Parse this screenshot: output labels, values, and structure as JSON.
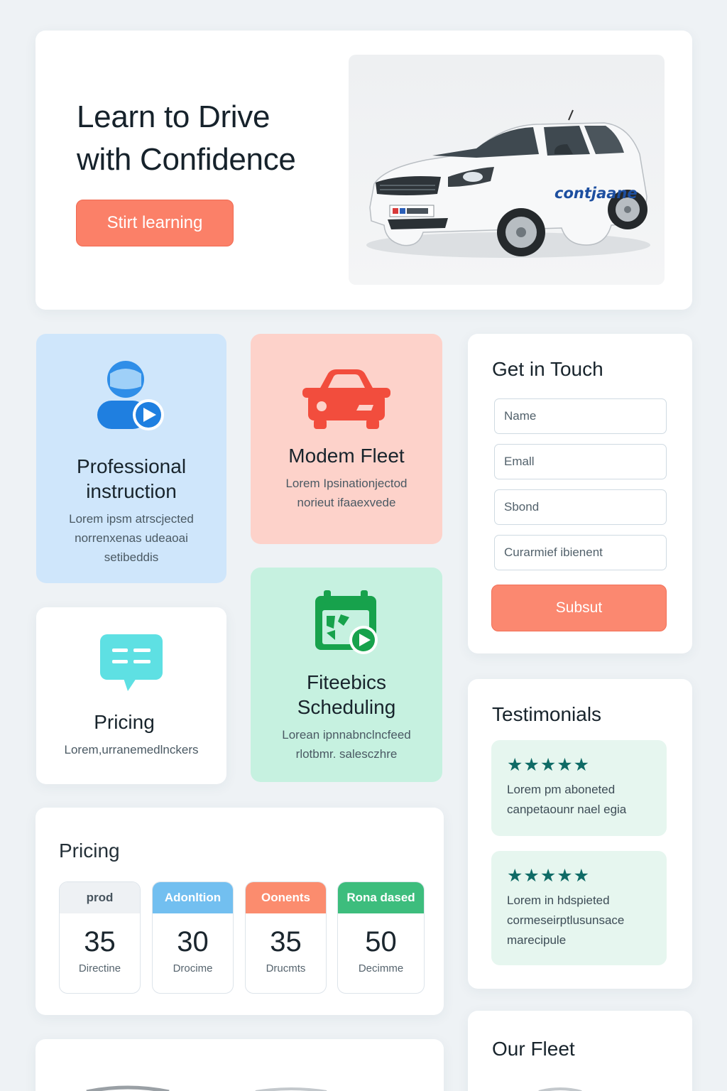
{
  "hero": {
    "title_line1": "Learn to Drive",
    "title_line2": "with Confidence",
    "cta_label": "Stirt learning",
    "car_brand_text": "contjaane"
  },
  "features": [
    {
      "icon": "instructor-icon",
      "title": "Professional instruction",
      "desc_line1": "Lorem ipsm atrscjected",
      "desc_line2": "norrenxenas udeaoai",
      "desc_line3": "setibeddis",
      "bg": "#cfe6fb"
    },
    {
      "icon": "car-icon",
      "title": "Modem Fleet",
      "desc_line1": "Lorem Ipsinationjectod",
      "desc_line2": "norieut ifaaexvede",
      "bg": "#fdd2ca"
    },
    {
      "icon": "chat-icon",
      "title": "Pricing",
      "desc_line1": "Lorem,urranemedlnckers",
      "bg": "#ffffff"
    },
    {
      "icon": "calendar-icon",
      "title_line1": "Fiteebics",
      "title_line2": "Scheduling",
      "desc_line1": "Lorean ipnnabnclncfeed",
      "desc_line2": "rlotbmr. salesczhre",
      "bg": "#c6f1e0"
    }
  ],
  "contact": {
    "title": "Get in Touch",
    "name_placeholder": "Name",
    "email_placeholder": "Emall",
    "subject_placeholder": "Sbond",
    "message_placeholder": "Curarmief ibienent",
    "submit_label": "Subsut"
  },
  "testimonials": {
    "title": "Testimonials",
    "items": [
      {
        "stars": "★★★★★",
        "line1": "Lorem pm aboneted",
        "line2": "canpetaounr nael egia"
      },
      {
        "stars": "★★★★★",
        "line1": "Lorem in hdspieted",
        "line2": "cormeseirptlusunsace",
        "line3": "marecipule"
      }
    ]
  },
  "pricing": {
    "title": "Pricing",
    "plans": [
      {
        "name": "prod",
        "price": "35",
        "label": "Directine",
        "color": "#eef1f4"
      },
      {
        "name": "Adonltion",
        "price": "30",
        "label": "Drocime",
        "color": "#72bff0"
      },
      {
        "name": "Oonents",
        "price": "35",
        "label": "Drucmts",
        "color": "#fb8c6e"
      },
      {
        "name": "Rona dased",
        "price": "50",
        "label": "Decimme",
        "color": "#3dbd7d"
      }
    ]
  },
  "fleet": {
    "title": "Our Fleet"
  },
  "colors": {
    "accent": "#fb8068",
    "teal_star": "#0f6b66",
    "background": "#eef2f5"
  }
}
